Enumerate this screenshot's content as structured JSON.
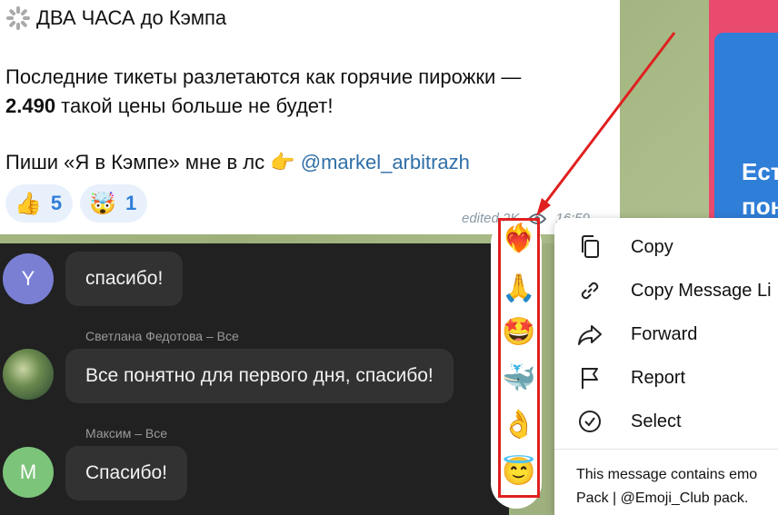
{
  "channel_message": {
    "title": "ДВА ЧАСА до Кэмпа",
    "line1": "Последние тикеты разлетаются как горячие пирожки —",
    "line2_bold": "2.490",
    "line2_rest": " такой цены больше не будет!",
    "line3_text": "Пиши «Я в Кэмпе» мне в лс 👉 ",
    "mention": "@markel_arbitrazh",
    "reactions": [
      {
        "emoji": "👍",
        "count": "5"
      },
      {
        "emoji": "🤯",
        "count": "1"
      }
    ],
    "meta": "edited  2K",
    "time": "16:59"
  },
  "right_panel": {
    "text1": "Ест",
    "text2": "пон"
  },
  "comments": [
    {
      "author": "",
      "initial": "Y",
      "text": "спасибо!",
      "avatar_color": "#7b7fd4"
    },
    {
      "author": "Светлана Федотова – Все",
      "initial": "",
      "text": "Все понятно для первого дня, спасибо!",
      "avatar_color": ""
    },
    {
      "author": "Максим – Все",
      "initial": "M",
      "text": "Спасибо!",
      "avatar_color": "#7cc47a"
    }
  ],
  "reaction_picker": [
    "❤️‍🔥",
    "🙏",
    "🤩",
    "🐳",
    "👌",
    "😇"
  ],
  "context_menu": {
    "items": [
      {
        "label": "Copy",
        "icon": "copy-icon"
      },
      {
        "label": "Copy Message Li",
        "icon": "link-icon"
      },
      {
        "label": "Forward",
        "icon": "forward-icon"
      },
      {
        "label": "Report",
        "icon": "flag-icon"
      },
      {
        "label": "Select",
        "icon": "check-circle-icon"
      }
    ],
    "footer_line1": "This message contains emo",
    "footer_line2": "Pack | @Emoji_Club pack."
  }
}
